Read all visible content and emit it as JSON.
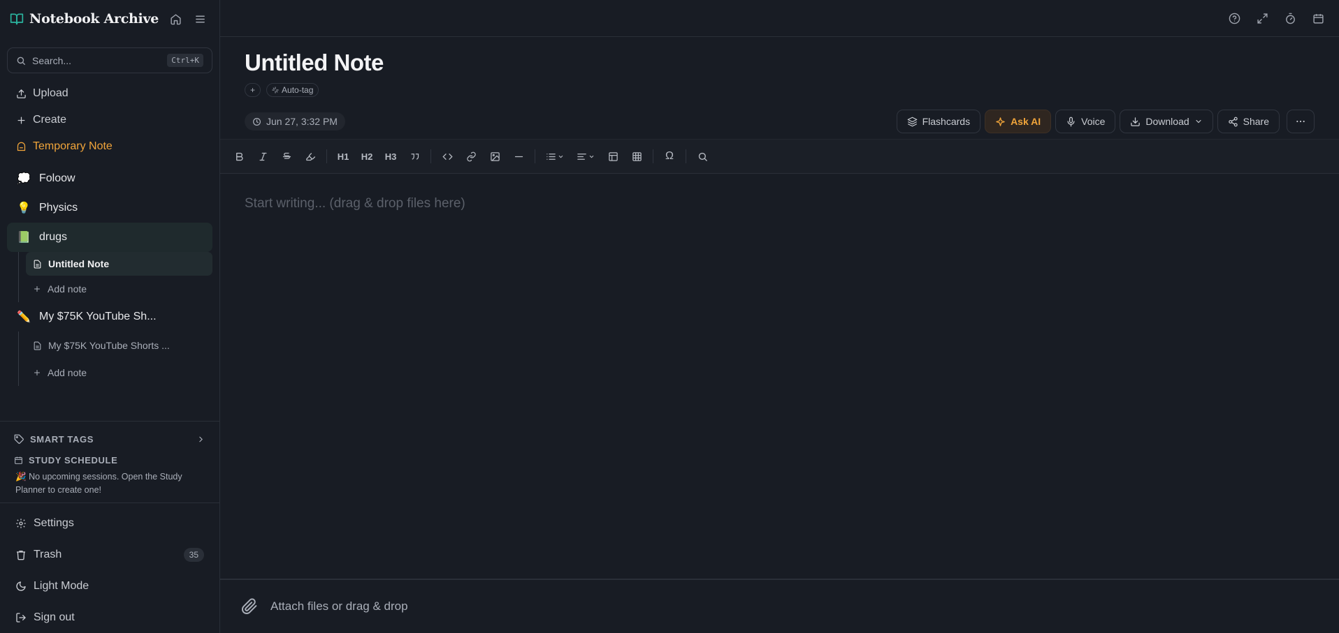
{
  "app": {
    "name": "Notebook Archive"
  },
  "sidebar": {
    "search": {
      "placeholder": "Search...",
      "shortcut": "Ctrl+K"
    },
    "actions": [
      {
        "label": "Upload",
        "icon": "upload-icon"
      },
      {
        "label": "Create",
        "icon": "plus-icon"
      },
      {
        "label": "Temporary Note",
        "icon": "temp-note-icon"
      }
    ],
    "notebooks": [
      {
        "emoji": "💭",
        "name": "Foloow"
      },
      {
        "emoji": "💡",
        "name": "Physics"
      },
      {
        "emoji": "📗",
        "name": "drugs",
        "notes": [
          "Untitled Note"
        ],
        "add_label": "Add note"
      },
      {
        "emoji": "✏️",
        "name": "My $75K YouTube Sh...",
        "notes": [
          "My $75K YouTube Shorts ..."
        ],
        "add_label": "Add note"
      }
    ],
    "smart_tags": {
      "label": "SMART TAGS"
    },
    "study_schedule": {
      "label": "STUDY SCHEDULE",
      "emoji": "🎉",
      "message": "No upcoming sessions. Open the Study Planner to create one!"
    },
    "bottom": {
      "settings": "Settings",
      "trash": "Trash",
      "trash_count": "35",
      "light_mode": "Light Mode",
      "sign_out": "Sign out"
    }
  },
  "note": {
    "title": "Untitled Note",
    "add_tag": "+",
    "auto_tag": "Auto-tag",
    "date": "Jun 27, 3:32 PM",
    "placeholder": "Start writing... (drag & drop files here)"
  },
  "note_actions": {
    "flashcards": "Flashcards",
    "ask_ai": "Ask AI",
    "voice": "Voice",
    "download": "Download",
    "share": "Share"
  },
  "toolbar": {
    "h1": "H1",
    "h2": "H2",
    "h3": "H3",
    "special_char": "Ω"
  },
  "attach": {
    "label": "Attach files or drag & drop"
  },
  "colors": {
    "accent": "#f0a43a",
    "background": "#181c24",
    "brand_icon": "#2bb5a0"
  }
}
